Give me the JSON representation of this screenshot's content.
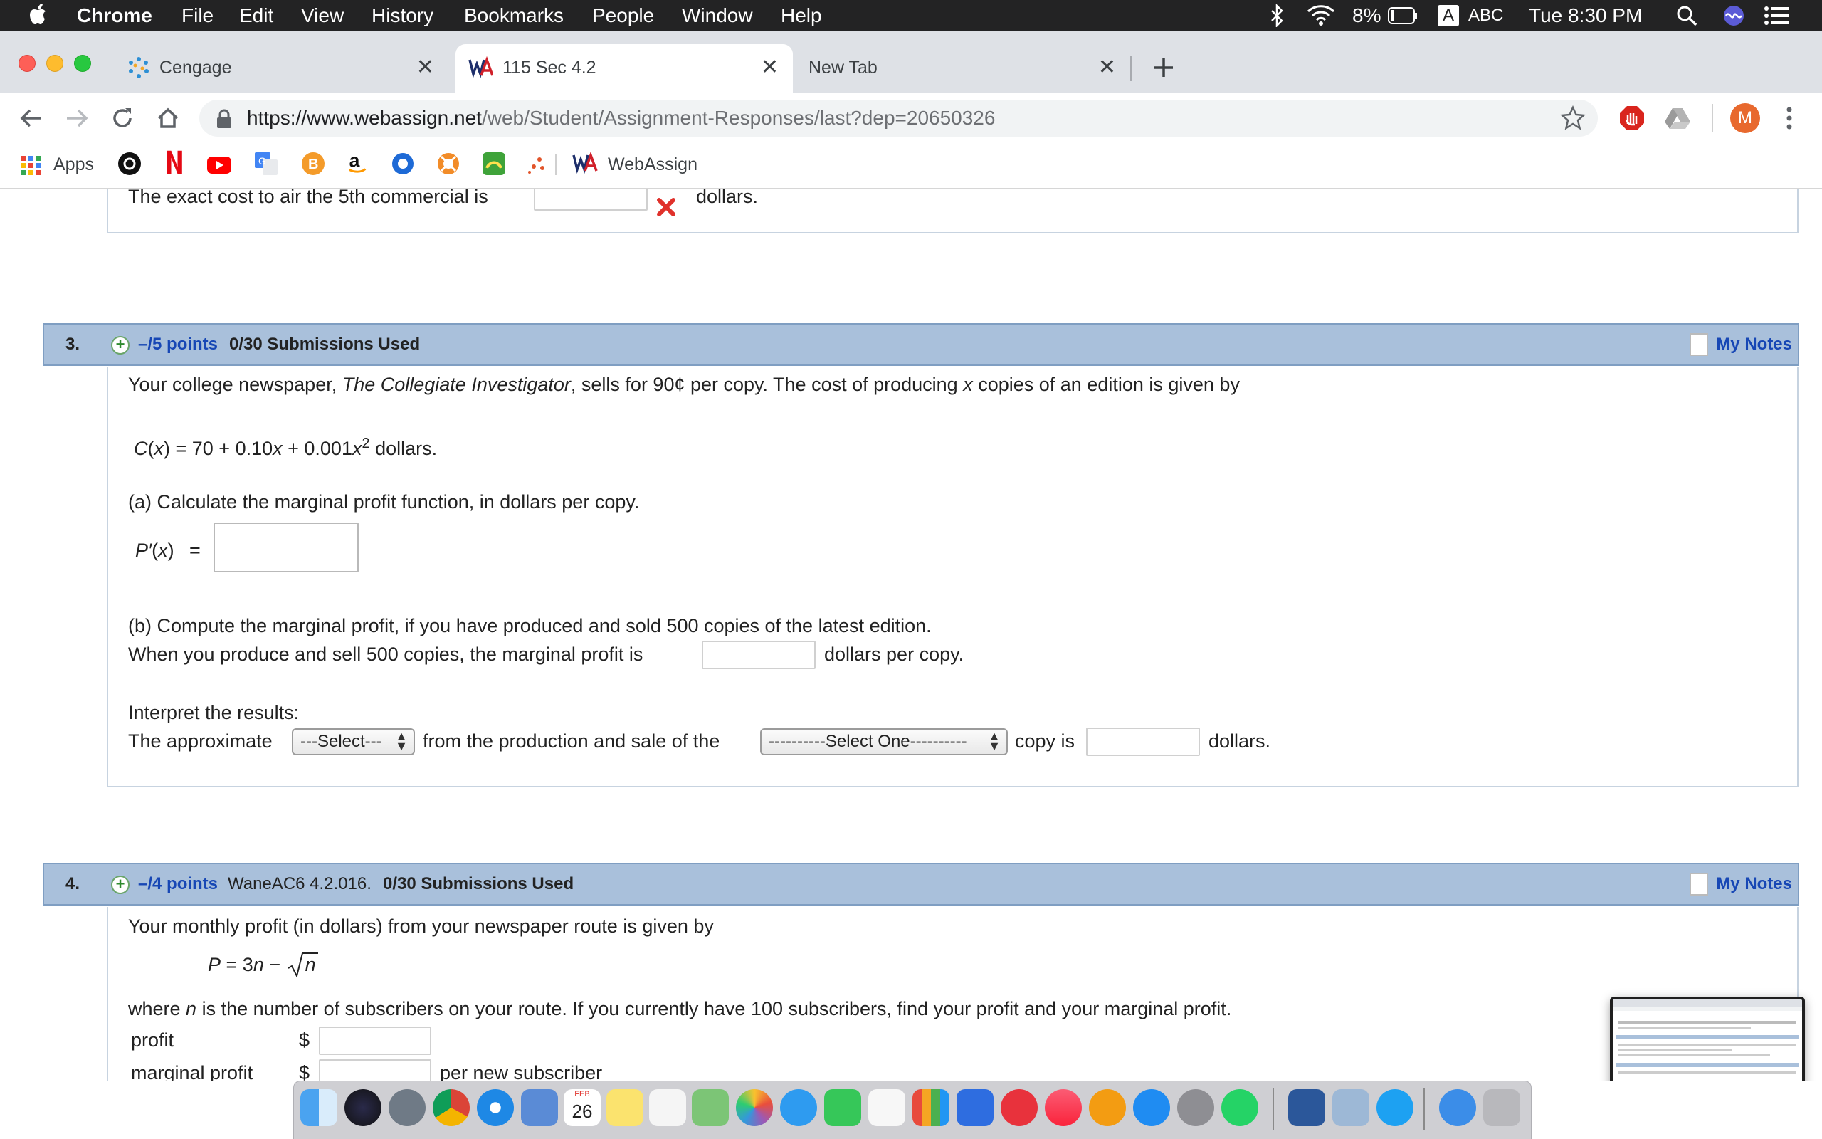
{
  "menubar": {
    "app_name": "Chrome",
    "menus": [
      "File",
      "Edit",
      "View",
      "History",
      "Bookmarks",
      "People",
      "Window",
      "Help"
    ],
    "battery": "8%",
    "input_source": "A",
    "input_label": "ABC",
    "clock": "Tue 8:30 PM"
  },
  "tabs": [
    {
      "title": "Cengage",
      "icon": "cengage-icon",
      "active": false
    },
    {
      "title": "115 Sec 4.2",
      "icon": "webassign-icon",
      "active": true
    },
    {
      "title": "New Tab",
      "icon": "",
      "active": false
    }
  ],
  "toolbar": {
    "url_host": "https://www.webassign.net",
    "url_path": "/web/Student/Assignment-Responses/last?dep=20650326",
    "profile_initial": "M"
  },
  "bookmarks": {
    "apps_label": "Apps",
    "webassign_label": "WebAssign"
  },
  "q2_tail": {
    "text_before": "The exact cost to air the 5th commercial is",
    "text_after": "dollars."
  },
  "q3": {
    "number": "3.",
    "points": "–/5 points",
    "submissions": "0/30 Submissions Used",
    "notes": "My Notes",
    "intro_a": "Your college newspaper, ",
    "intro_title": "The Collegiate Investigator",
    "intro_b": ", sells for 90¢ per copy. The cost of producing ",
    "intro_var": "x",
    "intro_c": " copies of an edition is given by",
    "formula_lhs": "C",
    "formula_arg": "x",
    "formula_mid": " = 70 + 0.10",
    "formula_x1": "x",
    "formula_plus": " + 0.001",
    "formula_x2": "x",
    "formula_exp": "2",
    "formula_units": " dollars.",
    "part_a": "(a) Calculate the marginal profit function, in dollars per copy.",
    "pprime_lhs": "P′",
    "pprime_arg": "x",
    "pprime_eq": "=",
    "part_b": "(b) Compute the marginal profit, if you have produced and sold 500 copies of the latest edition.",
    "b_before": "When you produce and sell 500 copies, the marginal profit is",
    "b_after": "dollars per copy.",
    "interpret_label": "Interpret the results:",
    "interp_1": "The approximate",
    "select1": "---Select---",
    "interp_2": "from the production and sale of the",
    "select2": "----------Select One----------",
    "interp_3": "copy is",
    "interp_4": "dollars."
  },
  "q4": {
    "number": "4.",
    "points": "–/4 points",
    "code": "WaneAC6 4.2.016.",
    "submissions": "0/30 Submissions Used",
    "notes": "My Notes",
    "intro": "Your monthly profit (in dollars) from your newspaper route is given by",
    "formula_p": "P",
    "formula_mid": " = 3",
    "formula_n": "n",
    "formula_minus": " − ",
    "formula_root_n": "n",
    "where_a": "where ",
    "where_n": "n",
    "where_b": " is the number of subscribers on your route. If you currently have 100 subscribers, find your profit and your marginal profit.",
    "profit_label": "profit",
    "dollar": "$",
    "marginal_label": "marginal profit",
    "per_sub": "per new subscriber"
  },
  "dock": {
    "calendar_month": "FEB",
    "calendar_day": "26"
  }
}
